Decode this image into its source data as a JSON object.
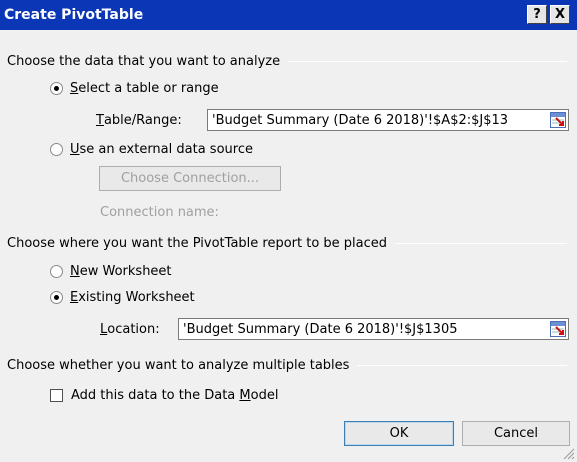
{
  "dialog": {
    "title": "Create PivotTable",
    "help_label": "?",
    "close_label": "X"
  },
  "data_section": {
    "header": "Choose the data that you want to analyze",
    "select_table": {
      "hotkey": "S",
      "rest": "elect a table or range",
      "selected": true
    },
    "table_range": {
      "label_hotkey": "T",
      "label_rest": "able/Range:",
      "value": "'Budget Summary (Date 6 2018)'!$A$2:$J$13"
    },
    "external": {
      "hotkey": "U",
      "rest": "se an external data source",
      "selected": false
    },
    "choose_connection_label": "Choose Connection...",
    "connection_name_label": "Connection name:"
  },
  "placement_section": {
    "header": "Choose where you want the PivotTable report to be placed",
    "new_worksheet": {
      "hotkey": "N",
      "rest": "ew Worksheet",
      "selected": false
    },
    "existing_worksheet": {
      "hotkey": "E",
      "rest": "xisting Worksheet",
      "selected": true
    },
    "location": {
      "label_hotkey": "L",
      "label_rest": "ocation:",
      "value": "'Budget Summary (Date 6 2018)'!$J$1305"
    }
  },
  "multi_section": {
    "header": "Choose whether you want to analyze multiple tables",
    "data_model": {
      "before": "Add this data to the Data ",
      "hotkey": "M",
      "after": "odel",
      "checked": false
    }
  },
  "buttons": {
    "ok_label": "OK",
    "cancel_label": "Cancel"
  },
  "icons": [
    "refedit-icon",
    "resize-grip-icon"
  ]
}
